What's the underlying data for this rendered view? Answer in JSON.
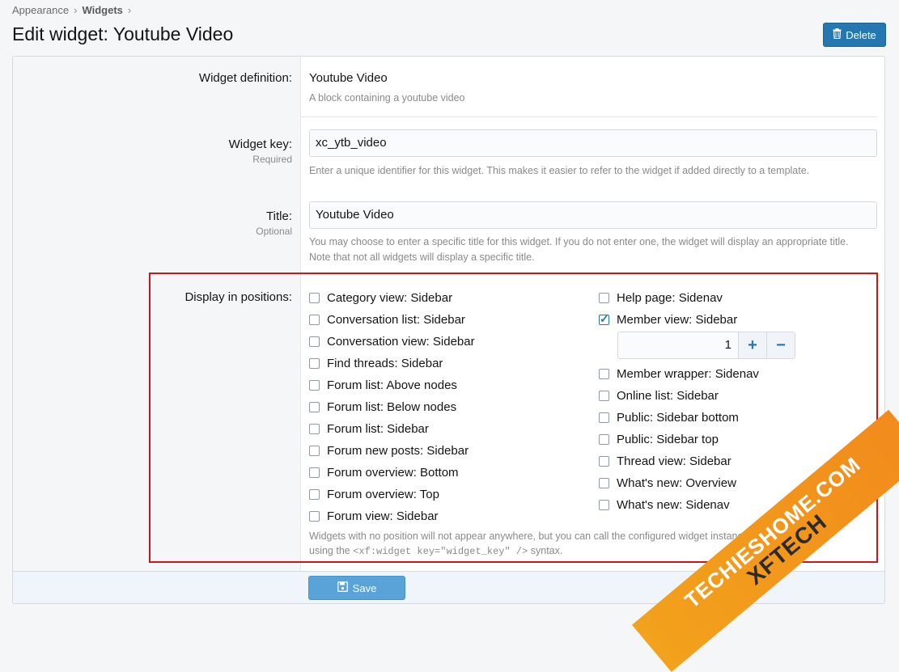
{
  "breadcrumb": {
    "parent": "Appearance",
    "current": "Widgets",
    "sep": "›"
  },
  "page": {
    "title": "Edit widget: Youtube Video",
    "delete_label": "Delete"
  },
  "form": {
    "definition": {
      "label": "Widget definition:",
      "value": "Youtube Video",
      "desc": "A block containing a youtube video"
    },
    "key": {
      "label": "Widget key:",
      "hint": "Required",
      "value": "xc_ytb_video",
      "desc": "Enter a unique identifier for this widget. This makes it easier to refer to the widget if added directly to a template."
    },
    "title": {
      "label": "Title:",
      "hint": "Optional",
      "value": "Youtube Video",
      "desc1": "You may choose to enter a specific title for this widget. If you do not enter one, the widget will display an appropriate title.",
      "desc2": "Note that not all widgets will display a specific title."
    },
    "positions": {
      "label": "Display in positions:",
      "left": [
        {
          "label": "Category view: Sidebar",
          "checked": false
        },
        {
          "label": "Conversation list: Sidebar",
          "checked": false
        },
        {
          "label": "Conversation view: Sidebar",
          "checked": false
        },
        {
          "label": "Find threads: Sidebar",
          "checked": false
        },
        {
          "label": "Forum list: Above nodes",
          "checked": false
        },
        {
          "label": "Forum list: Below nodes",
          "checked": false
        },
        {
          "label": "Forum list: Sidebar",
          "checked": false
        },
        {
          "label": "Forum new posts: Sidebar",
          "checked": false
        },
        {
          "label": "Forum overview: Bottom",
          "checked": false
        },
        {
          "label": "Forum overview: Top",
          "checked": false
        },
        {
          "label": "Forum view: Sidebar",
          "checked": false
        }
      ],
      "right_top": [
        {
          "label": "Help page: Sidenav",
          "checked": false
        },
        {
          "label": "Member view: Sidebar",
          "checked": true
        }
      ],
      "stepper_value": "1",
      "right_bottom": [
        {
          "label": "Member wrapper: Sidenav",
          "checked": false
        },
        {
          "label": "Online list: Sidebar",
          "checked": false
        },
        {
          "label": "Public: Sidebar bottom",
          "checked": false
        },
        {
          "label": "Public: Sidebar top",
          "checked": false
        },
        {
          "label": "Thread view: Sidebar",
          "checked": false
        },
        {
          "label": "What's new: Overview",
          "checked": false
        },
        {
          "label": "What's new: Sidenav",
          "checked": false
        }
      ],
      "desc_line1": "Widgets with no position will not appear anywhere, but you can call the configured widget instance directly in te",
      "desc_line2_pre": "using the",
      "desc_code": "<xf:widget key=\"widget_key\" />",
      "desc_line2_post": "syntax."
    }
  },
  "footer": {
    "save_label": "Save"
  },
  "watermark": {
    "line1": "TECHIESHOME.COM",
    "line2": "XFTECH"
  },
  "colors": {
    "accent": "#2577b1",
    "highlight": "#c8161d"
  }
}
